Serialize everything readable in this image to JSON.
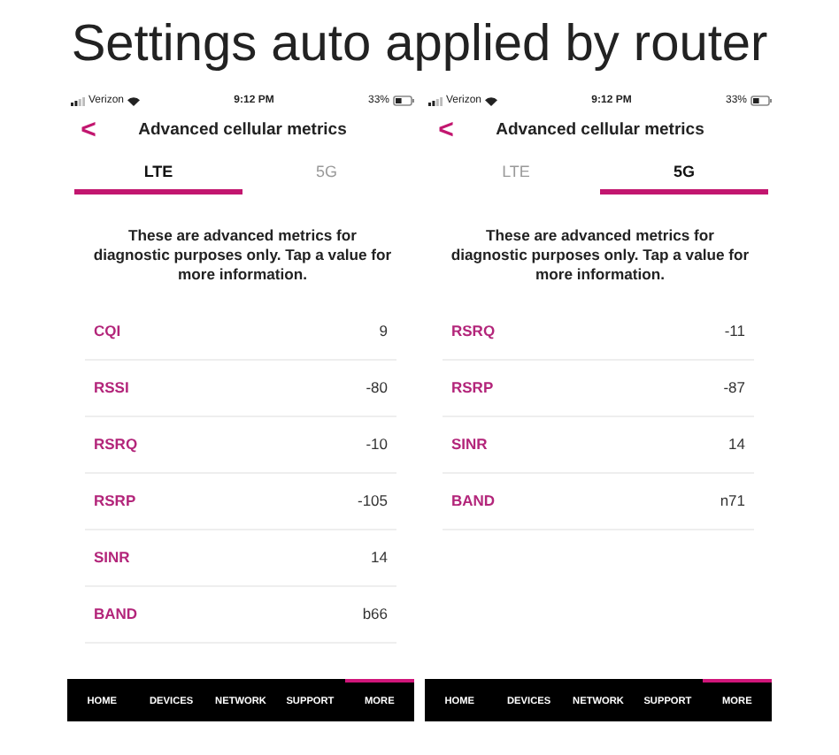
{
  "title": "Settings auto applied by router",
  "phones": [
    {
      "status": {
        "carrier": "Verizon",
        "time": "9:12 PM",
        "battery": "33%"
      },
      "header": {
        "back": "<",
        "title": "Advanced cellular metrics"
      },
      "tabs": [
        {
          "label": "LTE",
          "selected": true
        },
        {
          "label": "5G",
          "selected": false
        }
      ],
      "description": "These are advanced metrics for diagnostic purposes only. Tap a value for more information.",
      "rows": [
        {
          "label": "CQI",
          "value": "9"
        },
        {
          "label": "RSSI",
          "value": "-80"
        },
        {
          "label": "RSRQ",
          "value": "-10"
        },
        {
          "label": "RSRP",
          "value": "-105"
        },
        {
          "label": "SINR",
          "value": "14"
        },
        {
          "label": "BAND",
          "value": "b66"
        }
      ],
      "nav": [
        {
          "label": "HOME",
          "selected": false
        },
        {
          "label": "DEVICES",
          "selected": false
        },
        {
          "label": "NETWORK",
          "selected": false
        },
        {
          "label": "SUPPORT",
          "selected": false
        },
        {
          "label": "MORE",
          "selected": true
        }
      ]
    },
    {
      "status": {
        "carrier": "Verizon",
        "time": "9:12 PM",
        "battery": "33%"
      },
      "header": {
        "back": "<",
        "title": "Advanced cellular metrics"
      },
      "tabs": [
        {
          "label": "LTE",
          "selected": false
        },
        {
          "label": "5G",
          "selected": true
        }
      ],
      "description": "These are advanced metrics for diagnostic purposes only. Tap a value for more information.",
      "rows": [
        {
          "label": "RSRQ",
          "value": "-11"
        },
        {
          "label": "RSRP",
          "value": "-87"
        },
        {
          "label": "SINR",
          "value": "14"
        },
        {
          "label": "BAND",
          "value": "n71"
        }
      ],
      "nav": [
        {
          "label": "HOME",
          "selected": false
        },
        {
          "label": "DEVICES",
          "selected": false
        },
        {
          "label": "NETWORK",
          "selected": false
        },
        {
          "label": "SUPPORT",
          "selected": false
        },
        {
          "label": "MORE",
          "selected": true
        }
      ]
    }
  ]
}
